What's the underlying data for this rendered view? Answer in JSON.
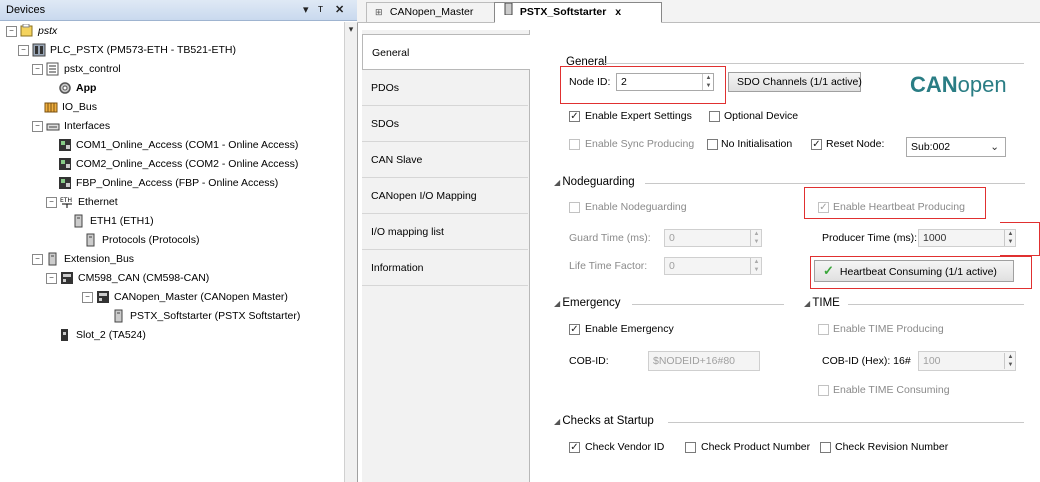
{
  "devices_panel": {
    "title": "Devices",
    "controls": [
      "▾",
      "ᴛ",
      "✕"
    ],
    "tree": [
      {
        "label": "pstx",
        "italic": true
      },
      {
        "label": "PLC_PSTX (PM573-ETH - TB521-ETH)"
      },
      {
        "label": "pstx_control"
      },
      {
        "label": "App",
        "bold": true
      },
      {
        "label": "IO_Bus"
      },
      {
        "label": "Interfaces"
      },
      {
        "label": "COM1_Online_Access (COM1 - Online Access)"
      },
      {
        "label": "COM2_Online_Access (COM2 - Online Access)"
      },
      {
        "label": "FBP_Online_Access (FBP - Online Access)"
      },
      {
        "label": "Ethernet"
      },
      {
        "label": "ETH1 (ETH1)"
      },
      {
        "label": "Protocols (Protocols)"
      },
      {
        "label": "Extension_Bus"
      },
      {
        "label": "CM598_CAN (CM598-CAN)"
      },
      {
        "label": "CANopen_Master (CANopen Master)"
      },
      {
        "label": "PSTX_Softstarter (PSTX Softstarter)"
      },
      {
        "label": "Slot_2 (TA524)"
      }
    ]
  },
  "tabs": {
    "tab1": "CANopen_Master",
    "tab2": "PSTX_Softstarter",
    "close": "x"
  },
  "vtabs": [
    "General",
    "PDOs",
    "SDOs",
    "CAN Slave",
    "CANopen I/O Mapping",
    "I/O mapping list",
    "Information"
  ],
  "general": {
    "section": "General",
    "node_id_label": "Node ID:",
    "node_id_value": "2",
    "sdo_button": "SDO Channels (1/1 active)",
    "logo": {
      "bold": "CAN",
      "rest": "open"
    },
    "enable_expert": "Enable Expert Settings",
    "optional_device": "Optional Device",
    "enable_sync": "Enable Sync Producing",
    "no_init": "No Initialisation",
    "reset_node": "Reset Node:",
    "reset_node_value": "Sub:002"
  },
  "nodeguarding": {
    "section": "Nodeguarding",
    "enable_nodeguarding": "Enable Nodeguarding",
    "guard_time_label": "Guard Time (ms):",
    "guard_time_value": "0",
    "life_time_label": "Life Time Factor:",
    "life_time_value": "0",
    "enable_heartbeat_producing": "Enable Heartbeat Producing",
    "producer_time_label": "Producer Time (ms):",
    "producer_time_value": "1000",
    "heartbeat_consuming_button": "Heartbeat Consuming (1/1 active)"
  },
  "emergency": {
    "section": "Emergency",
    "enable_emergency": "Enable Emergency",
    "cob_id_label": "COB-ID:",
    "cob_id_value": "$NODEID+16#80"
  },
  "time": {
    "section": "TIME",
    "enable_time_producing": "Enable TIME Producing",
    "cob_id_hex_label": "COB-ID (Hex):  16#",
    "cob_id_hex_value": "100",
    "enable_time_consuming": "Enable TIME Consuming"
  },
  "checks": {
    "section": "Checks at Startup",
    "vendor": "Check Vendor ID",
    "product": "Check Product Number",
    "revision": "Check Revision Number"
  },
  "colors": {
    "highlight": "#e03030",
    "logo_blue": "#2a7d84",
    "check_green": "#3aa63a"
  }
}
